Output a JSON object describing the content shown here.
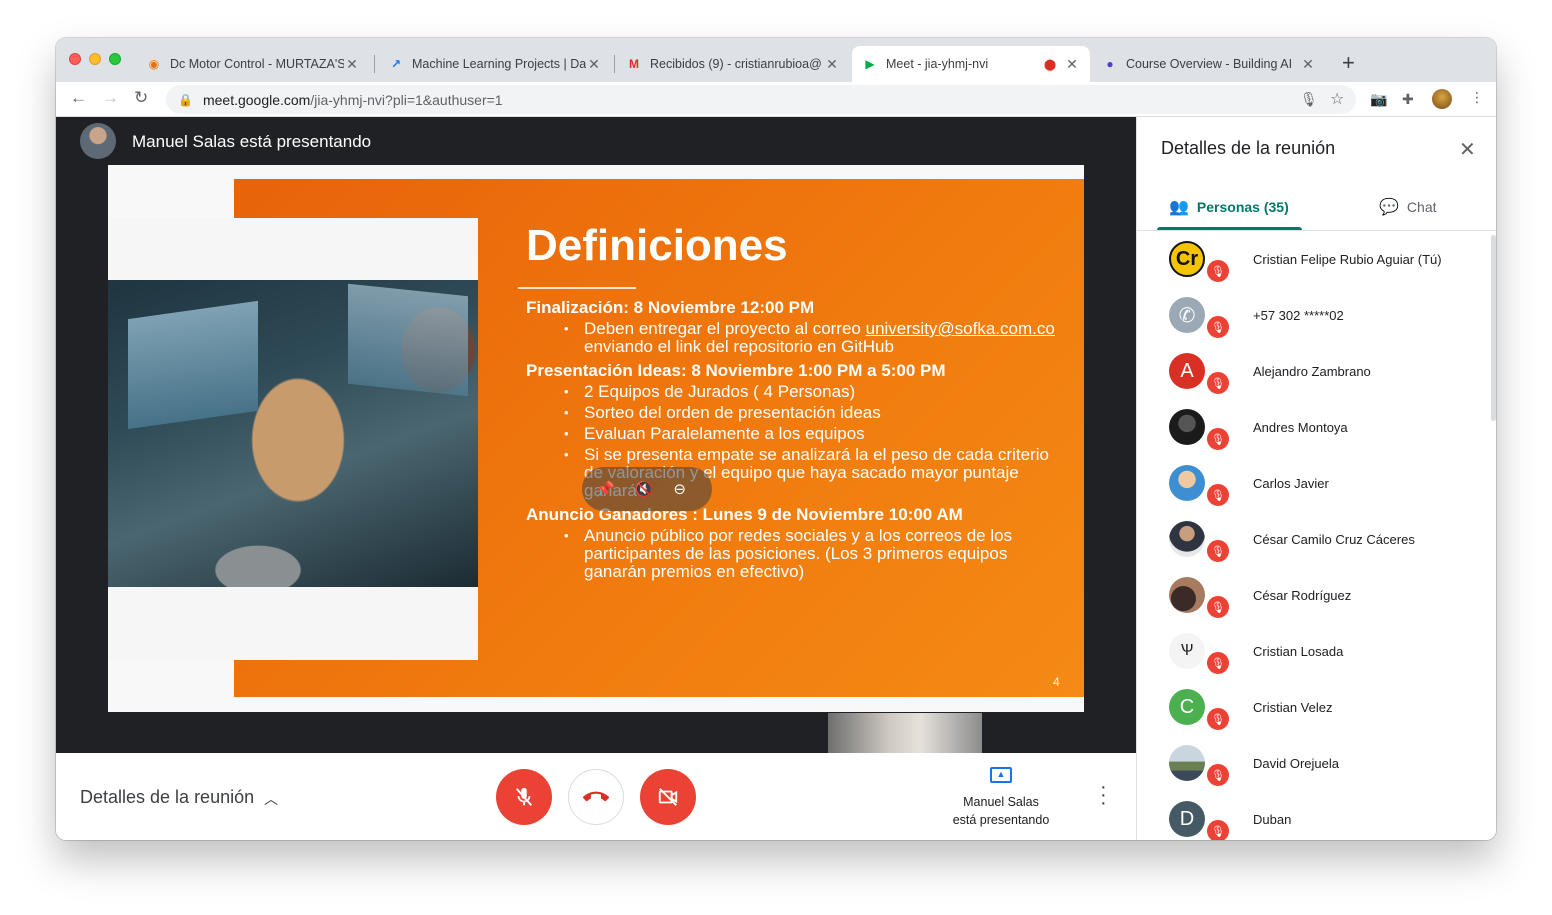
{
  "browser": {
    "tabs": [
      {
        "title": "Dc Motor Control - MURTAZA'S",
        "favicon": "robot-icon"
      },
      {
        "title": "Machine Learning Projects | Da",
        "favicon": "chart-icon"
      },
      {
        "title": "Recibidos (9) - cristianrubioa@",
        "favicon": "gmail-icon"
      },
      {
        "title": "Meet - jia-yhmj-nvi",
        "favicon": "meet-icon",
        "active": true
      },
      {
        "title": "Course Overview - Building AI",
        "favicon": "course-icon"
      }
    ],
    "url_host": "meet.google.com",
    "url_path": "/jia-yhmj-nvi?pli=1&authuser=1"
  },
  "presenter": {
    "label": "Manuel Salas está presentando"
  },
  "slide": {
    "title": "Definiciones",
    "section1_head": "Finalización: 8 Noviembre 12:00 PM",
    "section1_b1_pre": "Deben entregar el proyecto al correo ",
    "section1_b1_mail": "university@sofka.com.co",
    "section1_b1_post": " enviando el link del repositorio en GitHub",
    "section2_head": "Presentación Ideas: 8 Noviembre 1:00 PM a 5:00 PM",
    "section2_bullets": [
      "2 Equipos de Jurados ( 4 Personas)",
      "Sorteo del orden de presentación ideas",
      "Evaluan Paralelamente a los equipos",
      "Si se presenta empate se analizará la el peso de cada criterio de valoración y el equipo que haya sacado mayor puntaje ganará"
    ],
    "section3_head": "Anuncio Ganadores : Lunes 9 de Noviembre 10:00 AM",
    "section3_b1": "Anuncio público por redes sociales y a los correos de los participantes de las posiciones. (Los 3 primeros equipos ganarán premios en efectivo)",
    "page_number": "4"
  },
  "controls": {
    "details_label": "Detalles de la reunión",
    "presenting_line1": "Manuel Salas",
    "presenting_line2": "está presentando"
  },
  "panel": {
    "title": "Detalles de la reunión",
    "tab_people": "Personas (35)",
    "tab_chat": "Chat",
    "participants": [
      {
        "name": "Cristian Felipe Rubio Aguiar (Tú)",
        "avatar": "Cr",
        "color": "#f5c400"
      },
      {
        "name": "+57 302 *****02",
        "avatar": "phone-icon",
        "color": "#9aa9b5"
      },
      {
        "name": "Alejandro Zambrano",
        "avatar": "A",
        "color": "#d93025"
      },
      {
        "name": "Andres Montoya",
        "avatar": "",
        "color": "#2b2b2b"
      },
      {
        "name": "Carlos Javier",
        "avatar": "",
        "color": "#4a90c2"
      },
      {
        "name": "César Camilo Cruz Cáceres",
        "avatar": "",
        "color": "#d8d8d8"
      },
      {
        "name": "César Rodríguez",
        "avatar": "",
        "color": "#6a4b3a"
      },
      {
        "name": "Cristian Losada",
        "avatar": "",
        "color": "#f4f4f4"
      },
      {
        "name": "Cristian Velez",
        "avatar": "C",
        "color": "#4caf50"
      },
      {
        "name": "David Orejuela",
        "avatar": "",
        "color": "#8aa0b0"
      },
      {
        "name": "Duban",
        "avatar": "D",
        "color": "#455a64"
      }
    ]
  },
  "colors": {
    "accent": "#00796b",
    "danger": "#ea4335",
    "slide_orange": "#ee7410"
  }
}
